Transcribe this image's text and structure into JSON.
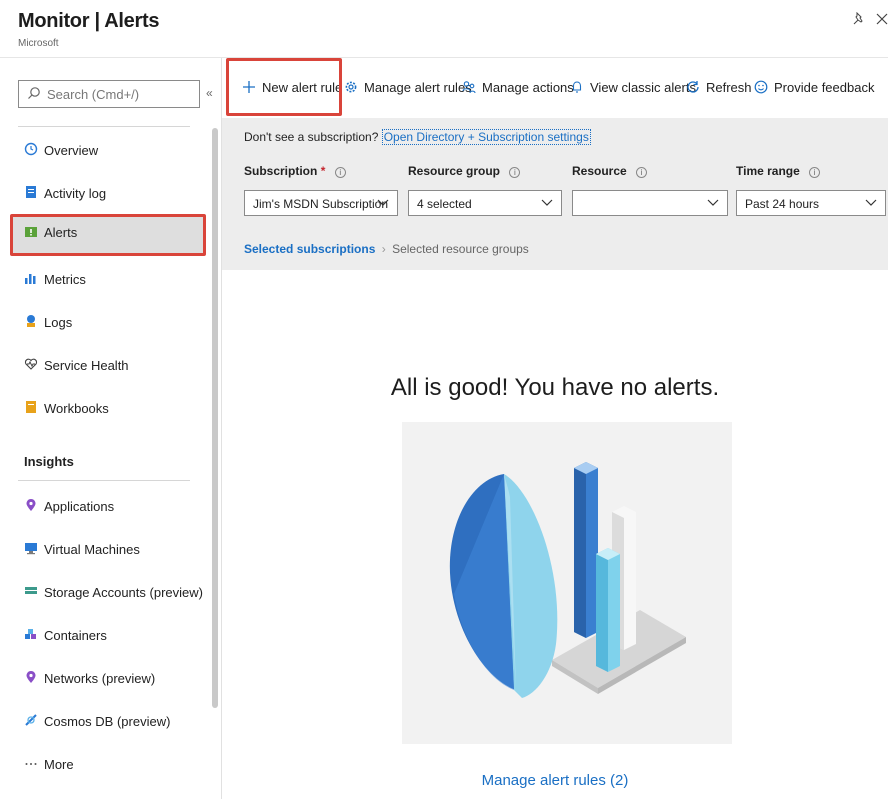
{
  "header": {
    "title": "Monitor | Alerts",
    "subtitle": "Microsoft"
  },
  "sidebar": {
    "search_placeholder": "Search (Cmd+/)",
    "collapse_glyph": "«",
    "items": [
      {
        "label": "Overview",
        "icon": "overview-icon"
      },
      {
        "label": "Activity log",
        "icon": "activity-log-icon"
      },
      {
        "label": "Alerts",
        "icon": "alerts-icon",
        "selected": true
      },
      {
        "label": "Metrics",
        "icon": "metrics-icon"
      },
      {
        "label": "Logs",
        "icon": "logs-icon"
      },
      {
        "label": "Service Health",
        "icon": "service-health-icon"
      },
      {
        "label": "Workbooks",
        "icon": "workbooks-icon"
      }
    ],
    "insights_label": "Insights",
    "insights_items": [
      {
        "label": "Applications",
        "icon": "applications-icon"
      },
      {
        "label": "Virtual Machines",
        "icon": "virtual-machines-icon"
      },
      {
        "label": "Storage Accounts (preview)",
        "icon": "storage-accounts-icon"
      },
      {
        "label": "Containers",
        "icon": "containers-icon"
      },
      {
        "label": "Networks (preview)",
        "icon": "networks-icon"
      },
      {
        "label": "Cosmos DB (preview)",
        "icon": "cosmos-db-icon"
      },
      {
        "label": "More",
        "icon": "more-icon"
      }
    ]
  },
  "toolbar": {
    "new_alert_rule": "New alert rule",
    "manage_alert_rules": "Manage alert rules",
    "manage_actions": "Manage actions",
    "view_classic_alerts": "View classic alerts",
    "refresh": "Refresh",
    "provide_feedback": "Provide feedback"
  },
  "filters": {
    "notice_text": "Don't see a subscription?",
    "notice_link": "Open Directory + Subscription settings",
    "subscription_label": "Subscription",
    "subscription_required": "*",
    "subscription_value": "Jim's MSDN Subscription",
    "resource_group_label": "Resource group",
    "resource_group_value": "4 selected",
    "resource_label": "Resource",
    "resource_value": "",
    "time_range_label": "Time range",
    "time_range_value": "Past 24 hours",
    "breadcrumb_active": "Selected subscriptions",
    "breadcrumb_next": "Selected resource groups"
  },
  "main": {
    "empty_title": "All is good! You have no alerts.",
    "manage_link": "Manage alert rules (2)"
  },
  "colors": {
    "accent": "#1a6fc4",
    "highlight": "#d9443a",
    "panel": "#ededed"
  }
}
